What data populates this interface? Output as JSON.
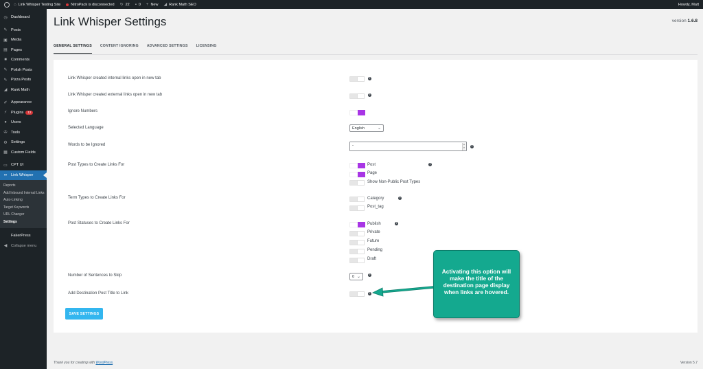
{
  "adminbar": {
    "site_name": "Link Whisper Testing Site",
    "nitropack": "NitroPack is disconnected",
    "updates_count": "22",
    "comments_count": "0",
    "new_label": "New",
    "rankmath": "Rank Math SEO",
    "howdy": "Howdy, Matt"
  },
  "sidebar": {
    "items": [
      {
        "label": "Dashboard",
        "icon": "dashboard-icon"
      },
      {
        "label": "Posts",
        "icon": "pin-icon"
      },
      {
        "label": "Media",
        "icon": "media-icon"
      },
      {
        "label": "Pages",
        "icon": "pages-icon"
      },
      {
        "label": "Comments",
        "icon": "comment-icon"
      },
      {
        "label": "Polish Posts",
        "icon": "pin-icon"
      },
      {
        "label": "Pizza Posts",
        "icon": "pin-icon"
      },
      {
        "label": "Rank Math",
        "icon": "chart-icon"
      },
      {
        "label": "Appearance",
        "icon": "brush-icon"
      },
      {
        "label": "Plugins",
        "icon": "plugin-icon",
        "badge": "12"
      },
      {
        "label": "Users",
        "icon": "user-icon"
      },
      {
        "label": "Tools",
        "icon": "wrench-icon"
      },
      {
        "label": "Settings",
        "icon": "settings-icon"
      },
      {
        "label": "Custom Fields",
        "icon": "grid-icon"
      },
      {
        "label": "CPT UI",
        "icon": "cpt-icon"
      },
      {
        "label": "Link Whisper",
        "icon": "link-whisper-icon"
      }
    ],
    "submenu": [
      "Reports",
      "Add Inbound Internal Links",
      "Auto-Linking",
      "Target Keywords",
      "URL Changer",
      "Settings"
    ],
    "after": [
      {
        "label": "FakerPress"
      },
      {
        "label": "Collapse menu",
        "icon": "collapse-icon"
      }
    ]
  },
  "page": {
    "title": "Link Whisper Settings",
    "version_prefix": "version",
    "version_number": "1.6.8"
  },
  "tabs": [
    "GENERAL SETTINGS",
    "CONTENT IGNORING",
    "ADVANCED SETTINGS",
    "LICENSING"
  ],
  "settings": {
    "internal_new_tab": {
      "label": "Link Whisper created internal links open in new tab",
      "enabled": false
    },
    "external_new_tab": {
      "label": "Link Whisper created external links open in new tab",
      "enabled": false
    },
    "ignore_numbers": {
      "label": "Ignore Numbers",
      "enabled": true
    },
    "language": {
      "label": "Selected Language",
      "value": "English"
    },
    "words_ignored": {
      "label": "Words to be Ignored",
      "value": "-"
    },
    "post_types": {
      "label": "Post Types to Create Links For",
      "options": [
        {
          "label": "Post",
          "enabled": true
        },
        {
          "label": "Page",
          "enabled": true
        },
        {
          "label": "Show Non-Public Post Types",
          "enabled": false
        }
      ]
    },
    "term_types": {
      "label": "Term Types to Create Links For",
      "options": [
        {
          "label": "Category",
          "enabled": false
        },
        {
          "label": "Post_tag",
          "enabled": false
        }
      ]
    },
    "post_statuses": {
      "label": "Post Statuses to Create Links For",
      "options": [
        {
          "label": "Publish",
          "enabled": true
        },
        {
          "label": "Private",
          "enabled": false
        },
        {
          "label": "Future",
          "enabled": false
        },
        {
          "label": "Pending",
          "enabled": false
        },
        {
          "label": "Draft",
          "enabled": false
        }
      ]
    },
    "sentences_skip": {
      "label": "Number of Sentences to Skip",
      "value": "0"
    },
    "destination_title": {
      "label": "Add Destination Post Title to Link",
      "enabled": false
    }
  },
  "save_label": "SAVE SETTINGS",
  "callout": "Activating this option will make the title of the destination page display when links are hovered.",
  "footer": {
    "thanks_prefix": "Thank you for creating with ",
    "wordpress_link": "WordPress",
    "thanks_suffix": ".",
    "wp_version": "Version 5.7"
  },
  "colors": {
    "accent": "#a835e5",
    "callout": "#14a98f",
    "button": "#33b6ef",
    "menu_active": "#2271b1"
  }
}
